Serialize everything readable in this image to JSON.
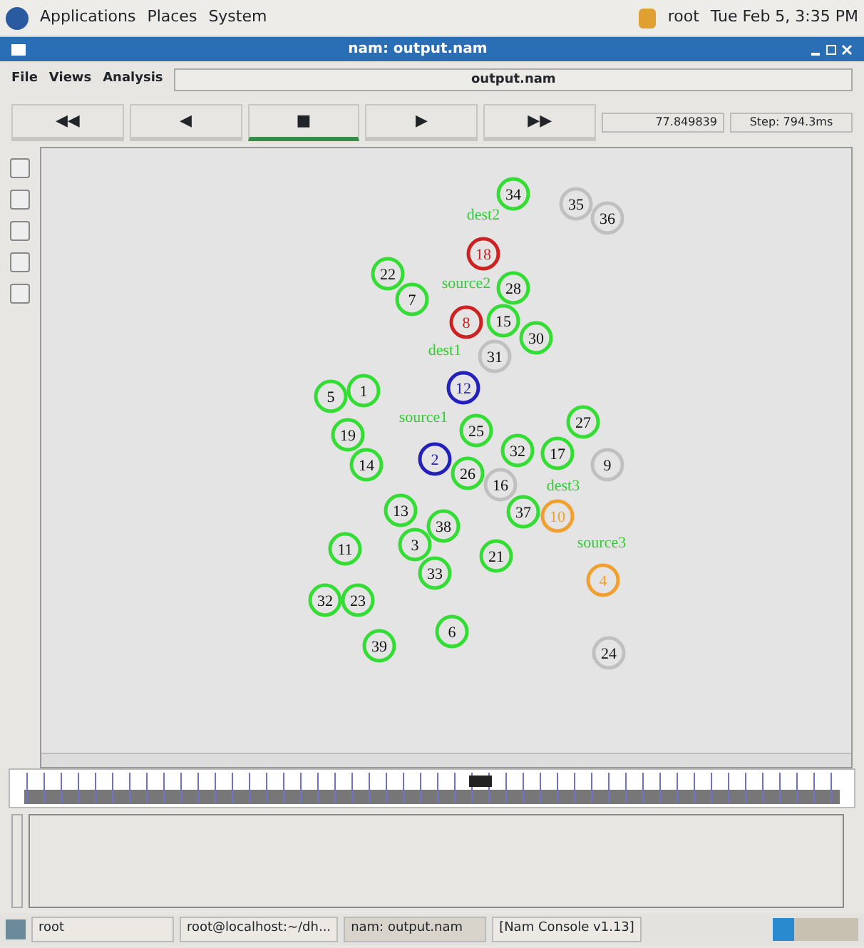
{
  "top_panel": {
    "menus": [
      "Applications",
      "Places",
      "System"
    ],
    "user": "root",
    "clock": "Tue Feb 5, 3:35 PM"
  },
  "window": {
    "title": "nam: output.nam"
  },
  "menu": [
    "File",
    "Views",
    "Analysis"
  ],
  "file_name": "output.nam",
  "playback": [
    {
      "symbol": "◀◀",
      "selected": false
    },
    {
      "symbol": "◀",
      "selected": false
    },
    {
      "symbol": "■",
      "selected": true
    },
    {
      "symbol": "▶",
      "selected": false
    },
    {
      "symbol": "▶▶",
      "selected": false
    }
  ],
  "time": "77.849839",
  "step": "Step: 794.3ms",
  "node_labels": [
    {
      "text": "dest2"
    },
    {
      "text": "source2"
    },
    {
      "text": "dest1"
    },
    {
      "text": "source1"
    },
    {
      "text": "dest3"
    },
    {
      "text": "source3"
    }
  ],
  "nodes": [
    {
      "label": "34",
      "color": "#33dd33"
    },
    {
      "label": "35",
      "color": "#c0c0c0"
    },
    {
      "label": "36",
      "color": "#c0c0c0"
    },
    {
      "label": "18",
      "color": "#cc2222"
    },
    {
      "label": "22",
      "color": "#33dd33"
    },
    {
      "label": "7",
      "color": "#33dd33"
    },
    {
      "label": "28",
      "color": "#33dd33"
    },
    {
      "label": "15",
      "color": "#33dd33"
    },
    {
      "label": "8",
      "color": "#cc2222"
    },
    {
      "label": "30",
      "color": "#33dd33"
    },
    {
      "label": "31",
      "color": "#c0c0c0"
    },
    {
      "label": "12",
      "color": "#2222bb"
    },
    {
      "label": "5",
      "color": "#33dd33"
    },
    {
      "label": "1",
      "color": "#33dd33"
    },
    {
      "label": "19",
      "color": "#33dd33"
    },
    {
      "label": "14",
      "color": "#33dd33"
    },
    {
      "label": "25",
      "color": "#33dd33"
    },
    {
      "label": "2",
      "color": "#2222bb"
    },
    {
      "label": "26",
      "color": "#33dd33"
    },
    {
      "label": "16",
      "color": "#c0c0c0"
    },
    {
      "label": "32",
      "color": "#33dd33"
    },
    {
      "label": "17",
      "color": "#33dd33"
    },
    {
      "label": "27",
      "color": "#33dd33"
    },
    {
      "label": "9",
      "color": "#c0c0c0"
    },
    {
      "label": "13",
      "color": "#33dd33"
    },
    {
      "label": "37",
      "color": "#33dd33"
    },
    {
      "label": "10",
      "color": "#f0a030"
    },
    {
      "label": "38",
      "color": "#33dd33"
    },
    {
      "label": "3",
      "color": "#33dd33"
    },
    {
      "label": "33",
      "color": "#33dd33"
    },
    {
      "label": "11",
      "color": "#33dd33"
    },
    {
      "label": "21",
      "color": "#33dd33"
    },
    {
      "label": "4",
      "color": "#f0a030"
    },
    {
      "label": "32",
      "color": "#33dd33"
    },
    {
      "label": "23",
      "color": "#33dd33"
    },
    {
      "label": "39",
      "color": "#33dd33"
    },
    {
      "label": "6",
      "color": "#33dd33"
    },
    {
      "label": "24",
      "color": "#c0c0c0"
    }
  ],
  "taskbar": [
    {
      "label": "root",
      "selected": false
    },
    {
      "label": "root@localhost:~/dh...",
      "selected": false
    },
    {
      "label": "nam: output.nam",
      "selected": true
    },
    {
      "label": "[Nam Console v1.13]",
      "selected": false
    }
  ]
}
